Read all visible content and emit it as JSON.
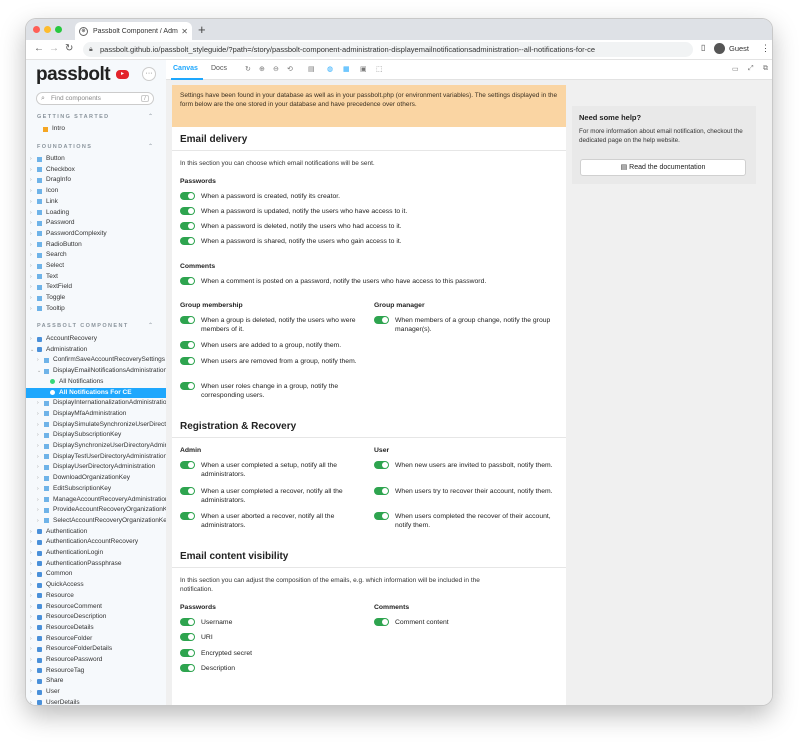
{
  "browser": {
    "tab_title": "Passbolt Component / Administ...",
    "url": "passbolt.github.io/passbolt_styleguide/?path=/story/passbolt-component-administration-displayemailnotificationsadministration--all-notifications-for-ce",
    "profile": "Guest"
  },
  "sidebar": {
    "logo": "passbolt",
    "search_placeholder": "Find components",
    "search_key": "/",
    "sections": {
      "getting_started": "GETTING STARTED",
      "foundations": "FOUNDATIONS",
      "passbolt_component": "PASSBOLT COMPONENT"
    },
    "getting_started": [
      "Intro"
    ],
    "foundations": [
      "Button",
      "Checkbox",
      "DragInfo",
      "Icon",
      "Link",
      "Loading",
      "Password",
      "PasswordComplexity",
      "RadioButton",
      "Search",
      "Select",
      "Text",
      "TextField",
      "Toggle",
      "Tooltip"
    ],
    "components": [
      "AccountRecovery",
      "Administration",
      "ConfirmSaveAccountRecoverySettings",
      "DisplayEmailNotificationsAdministration",
      "All Notifications",
      "All Notifications For CE",
      "DisplayInternationalizationAdministration",
      "DisplayMfaAdministration",
      "DisplaySimulateSynchronizeUserDirectory",
      "DisplaySubscriptionKey",
      "DisplaySynchronizeUserDirectoryAdministration",
      "DisplayTestUserDirectoryAdministration",
      "DisplayUserDirectoryAdministration",
      "DownloadOrganizationKey",
      "EditSubscriptionKey",
      "ManageAccountRecoveryAdministration",
      "ProvideAccountRecoveryOrganizationKey",
      "SelectAccountRecoveryOrganizationKey",
      "Authentication",
      "AuthenticationAccountRecovery",
      "AuthenticationLogin",
      "AuthenticationPassphrase",
      "Common",
      "QuickAccess",
      "Resource",
      "ResourceComment",
      "ResourceDescription",
      "ResourceDetails",
      "ResourceFolder",
      "ResourceFolderDetails",
      "ResourcePassword",
      "ResourceTag",
      "Share",
      "User",
      "UserDetails"
    ]
  },
  "toolbar": {
    "canvas": "Canvas",
    "docs": "Docs"
  },
  "notice": "Settings have been found in your database as well as in your passbolt.php (or environment variables). The settings displayed in the form below are the one stored in your database and have precedence over others.",
  "email_delivery": {
    "title": "Email delivery",
    "description": "In this section you can choose which email notifications will be sent.",
    "passwords": {
      "title": "Passwords",
      "items": [
        "When a password is created, notify its creator.",
        "When a password is updated, notify the users who have access to it.",
        "When a password is deleted, notify the users who had access to it.",
        "When a password is shared, notify the users who gain access to it."
      ]
    },
    "comments": {
      "title": "Comments",
      "items": [
        "When a comment is posted on a password, notify the users who have access to this password."
      ]
    },
    "group_membership": {
      "title": "Group membership",
      "items": [
        "When a group is deleted, notify the users who were members of it.",
        "When users are added to a group, notify them.",
        "When users are removed from a group, notify them.",
        "When user roles change in a group, notify the corresponding users."
      ]
    },
    "group_manager": {
      "title": "Group manager",
      "items": [
        "When members of a group change, notify the group manager(s)."
      ]
    }
  },
  "registration": {
    "title": "Registration & Recovery",
    "admin": {
      "title": "Admin",
      "items": [
        "When a user completed a setup, notify all the administrators.",
        "When a user completed a recover, notify all the administrators.",
        "When a user aborted a recover, notify all the administrators."
      ]
    },
    "user": {
      "title": "User",
      "items": [
        "When new users are invited to passbolt, notify them.",
        "When users try to recover their account, notify them.",
        "When users completed the recover of their account, notify them."
      ]
    }
  },
  "visibility": {
    "title": "Email content visibility",
    "description": "In this section you can adjust the composition of the emails, e.g. which information will be included in the notification.",
    "passwords": {
      "title": "Passwords",
      "items": [
        "Username",
        "URI",
        "Encrypted secret",
        "Description"
      ]
    },
    "comments": {
      "title": "Comments",
      "items": [
        "Comment content"
      ]
    }
  },
  "help": {
    "title": "Need some help?",
    "description": "For more information about email notification, checkout the dedicated page on the help website.",
    "button": "Read the documentation"
  },
  "colors": {
    "toggle_on": "#2ea44f",
    "accent": "#1ea7fd",
    "notice_bg": "#fad5a3"
  }
}
